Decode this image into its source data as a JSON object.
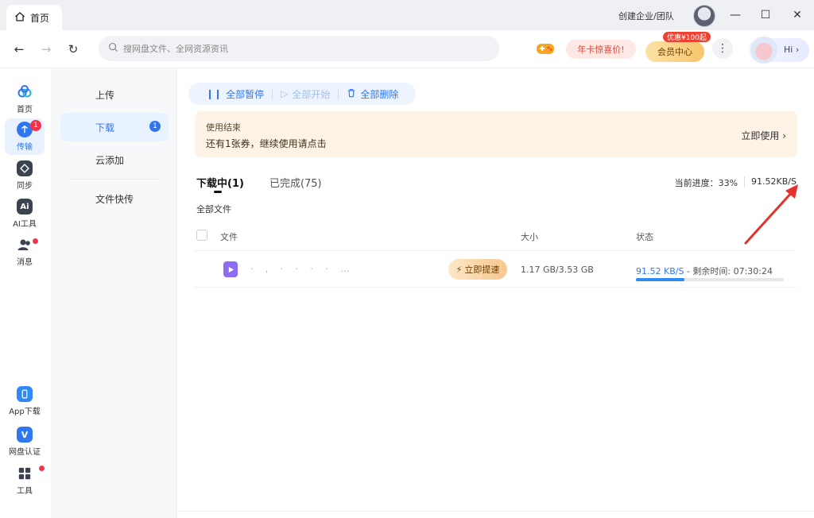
{
  "titlebar": {
    "tab_label": "首页",
    "org_link": "创建企业/团队",
    "controls": [
      "—",
      "☐",
      "✕"
    ]
  },
  "toolbar": {
    "search_placeholder": "搜网盘文件、全网资源资讯",
    "promo_label": "年卡惊喜价!",
    "vip_label": "会员中心",
    "vip_badge": "优惠¥100起",
    "more_label": "⋮",
    "hi_label": "Hi ›"
  },
  "rail": {
    "items": [
      {
        "label": "首页"
      },
      {
        "label": "传输",
        "badge": "1"
      },
      {
        "label": "同步"
      },
      {
        "label": "AI工具"
      },
      {
        "label": "消息"
      },
      {
        "label": "App下载"
      },
      {
        "label": "网盘认证"
      },
      {
        "label": "工具"
      }
    ]
  },
  "subnav": {
    "items": [
      {
        "label": "上传"
      },
      {
        "label": "下载",
        "badge": "1"
      },
      {
        "label": "云添加"
      },
      {
        "label": "文件快传"
      }
    ]
  },
  "main": {
    "actions": {
      "pause_all": "全部暂停",
      "start_all": "全部开始",
      "delete_all": "全部删除"
    },
    "notice": {
      "title": "使用结束",
      "body": "还有1张券，继续使用请点击",
      "link": "立即使用 ›"
    },
    "tabs": [
      {
        "label": "下载中(1)"
      },
      {
        "label": "已完成(75)"
      }
    ],
    "progress": {
      "label": "当前进度：33%",
      "speed": "91.52KB/S"
    },
    "all_files": "全部文件",
    "table": {
      "headers": {
        "file": "文件",
        "size": "大小",
        "status": "状态"
      },
      "rows": [
        {
          "name": "· ˌ  ·  ·   ·  ·  …",
          "boost": "立即提速",
          "size": "1.17 GB/3.53 GB",
          "speed": "91.52 KB/S",
          "remaining": " - 剩余时间: 07:30:24",
          "progress": 0.33
        }
      ]
    }
  },
  "colors": {
    "accent": "#2f77f1",
    "badge_red": "#f2334a",
    "notice_bg": "#fdf3e7",
    "arrow_red": "#e5322d"
  }
}
